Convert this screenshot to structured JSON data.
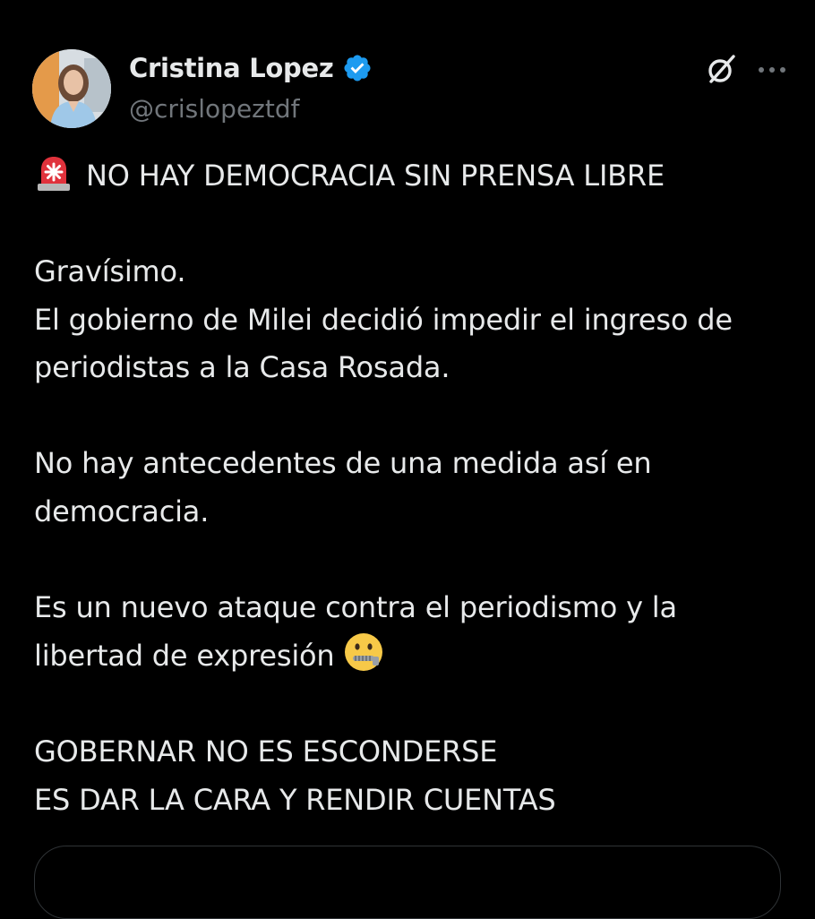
{
  "author": {
    "display_name": "Cristina Lopez",
    "handle": "@crislopeztdf",
    "verified": true,
    "verified_color": "#1d9bf0"
  },
  "icons": {
    "verified": "verified-badge-icon",
    "grok": "grok-icon",
    "more": "more-options-icon",
    "alarm": "police-light-emoji",
    "zipper": "zipper-mouth-emoji"
  },
  "tweet": {
    "line1": "NO HAY DEMOCRACIA SIN PRENSA LIBRE",
    "line2": "Gravísimo.",
    "line3": "El gobierno de Milei decidió impedir el ingreso de",
    "line4": "periodistas a la Casa Rosada.",
    "line5": "No hay antecedentes de una medida así en",
    "line6": "democracia.",
    "line7": "Es un nuevo ataque contra el periodismo y la",
    "line8": "libertad de expresión",
    "line9": "GOBERNAR NO ES ESCONDERSE",
    "line10": "ES DAR LA CARA Y RENDIR CUENTAS"
  },
  "colors": {
    "background": "#000000",
    "text": "#e7e9ea",
    "secondary_text": "#71767b",
    "border": "#2f3336"
  }
}
